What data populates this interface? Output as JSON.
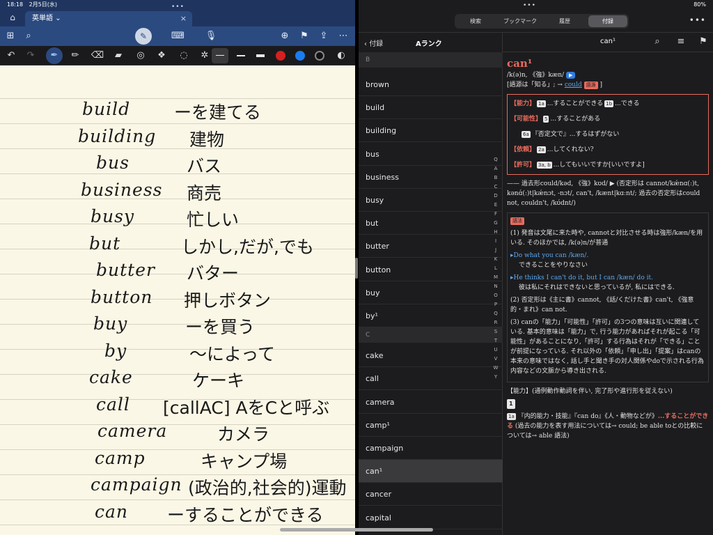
{
  "left_status": {
    "time": "18:18",
    "date": "2月5日(水)"
  },
  "left_tab": {
    "title": "英単語",
    "chevron": "⌄",
    "close": "×"
  },
  "left_toolbar_icons": [
    "home-icon",
    "grid-icon",
    "search-icon",
    "pen-mode-icon",
    "keyboard-icon",
    "mic-icon",
    "add-page-icon",
    "bookmark-icon",
    "share-icon",
    "more-icon"
  ],
  "left_tools": {
    "undo": "↶",
    "redo": "↷",
    "colors": [
      "#d42020",
      "#1a7cf0",
      "#111111"
    ]
  },
  "notes": [
    {
      "en": "build",
      "ja": "ーを建てる"
    },
    {
      "en": "building",
      "ja": "建物"
    },
    {
      "en": "bus",
      "ja": "バス"
    },
    {
      "en": "business",
      "ja": "商売"
    },
    {
      "en": "busy",
      "ja": "忙しい"
    },
    {
      "en": "but",
      "ja": "しかし,だが,でも"
    },
    {
      "en": "butter",
      "ja": "バター"
    },
    {
      "en": "button",
      "ja": "押しボタン"
    },
    {
      "en": "buy",
      "ja": "ーを買う"
    },
    {
      "en": "by",
      "ja": "〜によって"
    },
    {
      "en": "cake",
      "ja": "ケーキ"
    },
    {
      "en": "call",
      "ja": "[callAC] AをCと呼ぶ"
    },
    {
      "en": "camera",
      "ja": "カメラ"
    },
    {
      "en": "camp",
      "ja": "キャンプ場"
    },
    {
      "en": "campaign",
      "ja": "(政治的,社会的)運動"
    },
    {
      "en": "can",
      "ja": "ーすることができる"
    }
  ],
  "right_status": {
    "battery": "80%"
  },
  "segments": [
    "検索",
    "ブックマーク",
    "履歴",
    "付録"
  ],
  "active_segment": "付録",
  "list": {
    "back_label": "付録",
    "title": "Aランク",
    "section_b": "B",
    "section_c": "C",
    "items_b": [
      "brown",
      "build",
      "building",
      "bus",
      "business",
      "busy",
      "but",
      "butter",
      "button",
      "buy",
      "by¹"
    ],
    "items_c": [
      "cake",
      "call",
      "camera",
      "camp¹",
      "campaign",
      "can¹",
      "cancer",
      "capital"
    ],
    "selected": "can¹",
    "az": [
      "Q",
      "A",
      "B",
      "C",
      "D",
      "E",
      "F",
      "G",
      "H",
      "I",
      "J",
      "K",
      "L",
      "M",
      "N",
      "O",
      "P",
      "Q",
      "R",
      "S",
      "T",
      "U",
      "V",
      "W",
      "Y"
    ]
  },
  "entry": {
    "head_title": "can¹",
    "headword": "can¹",
    "pron": "/k(ə)n, 《強》kæn/",
    "play": "▶",
    "origin": "[語源は「知る」; → ",
    "origin_link": "could",
    "origin_tag": "語源",
    "origin_end": " ]",
    "meanings": [
      {
        "label": "【能力】",
        "n1": "1a",
        "t1": "...することができる",
        "n2": "1b",
        "t2": "...できる"
      },
      {
        "label": "【可能性】",
        "n1": "5",
        "t1": "...することがある",
        "n2": "",
        "t2": ""
      },
      {
        "label": "",
        "n1": "6a",
        "t1": "『否定文で』...するはずがない",
        "n2": "",
        "t2": ""
      },
      {
        "label": "【依頼】",
        "n1": "2a",
        "t1": "...してくれない?",
        "n2": "",
        "t2": ""
      },
      {
        "label": "【許可】",
        "n1": "3a, b",
        "t1": "...してもいいですか[いいですよ]",
        "n2": "",
        "t2": ""
      }
    ],
    "past": "—— 過去形could/kəd, 《強》kʊd/ ▶ (否定形は cannot/kǽnɑ(ː)t, kənɑ́(ː)t|kǽnɔt, -nɔt/, can't, /kænt|kɑːnt/; 過去の否定形はcould not, couldn't, /kʊ́dnt/)",
    "usage_tag": "語法",
    "usage_1": "(1) 発音は文尾に来た時や, cannotと対比させる時は強形/kæn/を用いる. そのほかでは, /k(ə)n/が普通",
    "ex1_en": "▸Do what you can /kæn/.",
    "ex1_ja": "できることをやりなさい",
    "ex2_en": "▸He thinks I can't do it, but I can /kæn/ do it.",
    "ex2_ja": "彼は私にそれはできないと思っているが, 私にはできる.",
    "usage_2": "(2) 否定形は《主に書》cannot, 《話/くだけた書》can't, 《強意的・まれ》can not.",
    "usage_3": "(3) canの「能力」「可能性」「許可」の3つの意味は互いに関連している. 基本的意味は「能力」で, 行う能力があればそれが起こる「可能性」があることになり,「許可」する行為はそれが「できる」ことが前提になっている. それ以外の「依頼」「申し出」「提案」はcanの本来の意味ではなく, 話し手と聞き手の対人関係やdoで示される行為内容などの文脈から導き出される.",
    "ability_head": "【能力】(通例動作動詞を伴い, 完了形や進行形を従えない)",
    "sense1_num": "1",
    "sense1a_num": "1a",
    "sense1a_text": "『内的能力・技能』『can do』《人・動物などが》",
    "sense1a_red": "...することができる",
    "sense1a_rest": " (過去の能力を表す用法については→ could; be able toとの比較については→ able 語法)"
  }
}
